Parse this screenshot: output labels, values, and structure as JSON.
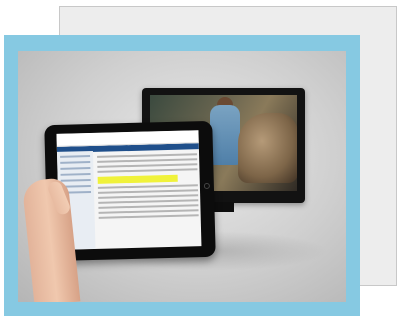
{
  "figure": {
    "image_description": "",
    "tablet": {
      "site_title": ""
    }
  },
  "colors": {
    "frame_blue": "#86c9e2",
    "back_panel": "#ededed",
    "highlight_yellow": "#f0f23a",
    "nav_blue": "#1f4f8b"
  }
}
